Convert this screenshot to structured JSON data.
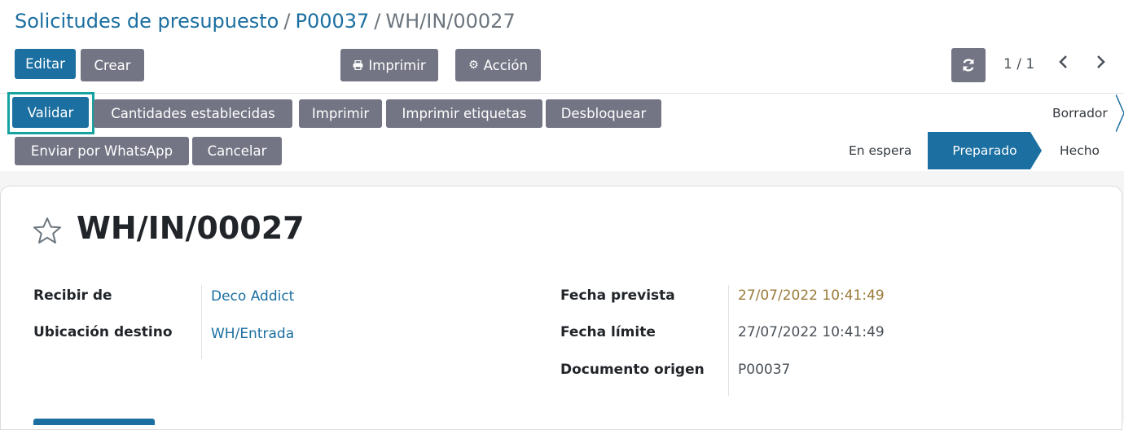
{
  "breadcrumb": {
    "items": [
      "Solicitudes de presupuesto",
      "P00037"
    ],
    "separator": "/",
    "current": "WH/IN/00027"
  },
  "control_panel": {
    "edit_label": "Editar",
    "create_label": "Crear",
    "print_label": "Imprimir",
    "action_label": "Acción",
    "pager_value": "1 / 1"
  },
  "header_buttons": {
    "validate": "Validar",
    "set_quantities": "Cantidades establecidas",
    "print": "Imprimir",
    "print_labels": "Imprimir etiquetas",
    "unlock": "Desbloquear",
    "whatsapp": "Enviar por WhatsApp",
    "cancel": "Cancelar"
  },
  "status": {
    "steps": [
      "Borrador",
      "En espera",
      "Preparado",
      "Hecho"
    ],
    "active": "Preparado"
  },
  "record": {
    "title": "WH/IN/00027",
    "fields_left": [
      {
        "label": "Recibir de",
        "value": "Deco Addict"
      },
      {
        "label": "Ubicación destino",
        "value": "WH/Entrada"
      }
    ],
    "fields_right": [
      {
        "label": "Fecha prevista",
        "value": "27/07/2022 10:41:49"
      },
      {
        "label": "Fecha límite",
        "value": "27/07/2022 10:41:49"
      },
      {
        "label": "Documento origen",
        "value": "P00037"
      }
    ]
  },
  "colors": {
    "primary": "#1b6fa1",
    "secondary": "#737484",
    "highlight_border": "#17a2a2",
    "warning_text": "#9a7b3a"
  }
}
